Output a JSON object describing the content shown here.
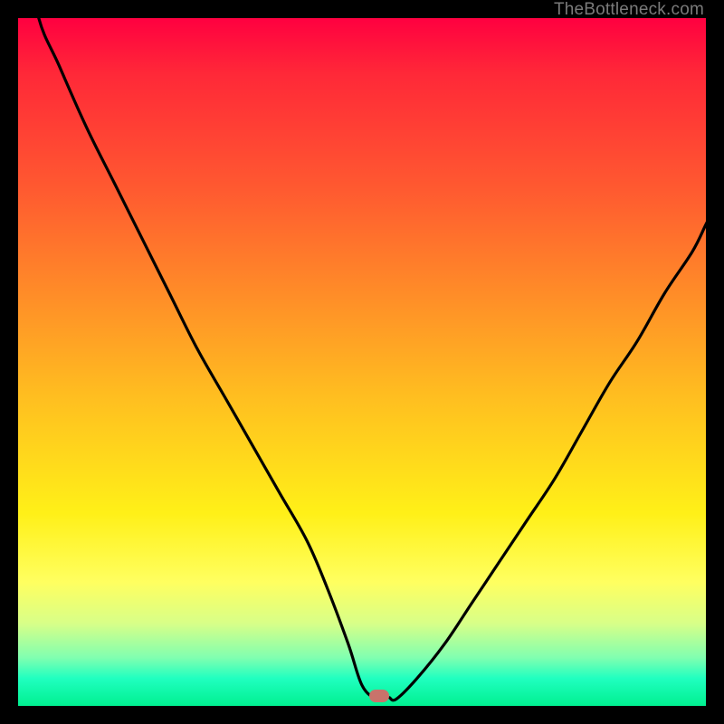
{
  "watermark": "TheBottleneck.com",
  "marker": {
    "x_pct": 52.5,
    "y_pct": 98.5
  },
  "chart_data": {
    "type": "line",
    "title": "",
    "xlabel": "",
    "ylabel": "",
    "xlim": [
      0,
      100
    ],
    "ylim": [
      0,
      100
    ],
    "annotations": [
      "TheBottleneck.com"
    ],
    "series": [
      {
        "name": "bottleneck-curve-left",
        "x": [
          3,
          6,
          10,
          14,
          18,
          22,
          26,
          30,
          34,
          38,
          42,
          45,
          48,
          50,
          52
        ],
        "y": [
          100,
          93,
          84,
          76,
          68,
          60,
          52,
          45,
          38,
          31,
          24,
          17,
          9,
          3,
          1
        ]
      },
      {
        "name": "bottleneck-curve-right",
        "x": [
          55,
          58,
          62,
          66,
          70,
          74,
          78,
          82,
          86,
          90,
          94,
          98,
          100
        ],
        "y": [
          1,
          4,
          9,
          15,
          21,
          27,
          33,
          40,
          47,
          53,
          60,
          66,
          70
        ]
      }
    ],
    "background_gradient": {
      "top": "#ff0040",
      "mid1": "#ff8c28",
      "mid2": "#fff018",
      "bottom": "#00f090"
    },
    "optimum_marker": {
      "x": 52.5,
      "y": 1.5,
      "color": "#c9736b"
    }
  }
}
